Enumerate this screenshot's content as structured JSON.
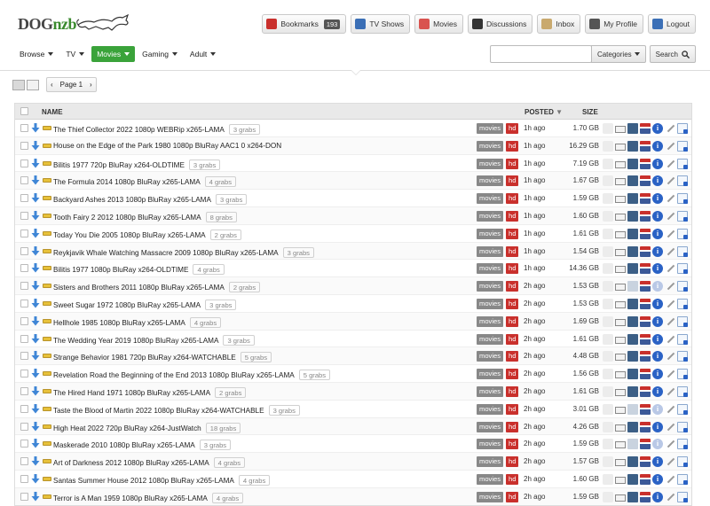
{
  "logo": {
    "part1": "DOG",
    "part2": "nzb"
  },
  "top_buttons": [
    {
      "label": "Bookmarks",
      "count": "193",
      "icon": "bookmark-icon",
      "color": "#c9302c"
    },
    {
      "label": "TV Shows",
      "icon": "tv-icon",
      "color": "#3b6fb6"
    },
    {
      "label": "Movies",
      "icon": "popcorn-icon",
      "color": "#d9534f"
    },
    {
      "label": "Discussions",
      "icon": "chat-bubble-icon",
      "color": "#333333"
    },
    {
      "label": "Inbox",
      "icon": "envelope-icon",
      "color": "#c9a96e"
    },
    {
      "label": "My Profile",
      "icon": "user-icon",
      "color": "#555555"
    },
    {
      "label": "Logout",
      "icon": "power-icon",
      "color": "#3b6fb6"
    }
  ],
  "nav": [
    {
      "label": "Browse"
    },
    {
      "label": "TV"
    },
    {
      "label": "Movies",
      "active": true
    },
    {
      "label": "Gaming"
    },
    {
      "label": "Adult"
    }
  ],
  "search": {
    "placeholder": "",
    "categories_label": "Categories",
    "search_label": "Search"
  },
  "pager": {
    "label": "Page 1"
  },
  "table": {
    "columns": {
      "name": "NAME",
      "posted": "POSTED",
      "size": "SIZE"
    },
    "rows": [
      {
        "title": "The Thief Collector 2022 1080p WEBRip x265-LAMA",
        "grabs": "3 grabs",
        "cat": "movies",
        "tag": "hd",
        "posted": "1h ago",
        "size": "1.70 GB",
        "active": true
      },
      {
        "title": "House on the Edge of the Park 1980 1080p BluRay AAC1 0 x264-DON",
        "grabs": "",
        "cat": "movies",
        "tag": "hd",
        "posted": "1h ago",
        "size": "16.29 GB",
        "active": true
      },
      {
        "title": "Bilitis 1977 720p BluRay x264-OLDTIME",
        "grabs": "3 grabs",
        "cat": "movies",
        "tag": "hd",
        "posted": "1h ago",
        "size": "7.19 GB",
        "active": true
      },
      {
        "title": "The Formula 2014 1080p BluRay x265-LAMA",
        "grabs": "4 grabs",
        "cat": "movies",
        "tag": "hd",
        "posted": "1h ago",
        "size": "1.67 GB",
        "active": true
      },
      {
        "title": "Backyard Ashes 2013 1080p BluRay x265-LAMA",
        "grabs": "3 grabs",
        "cat": "movies",
        "tag": "hd",
        "posted": "1h ago",
        "size": "1.59 GB",
        "active": true
      },
      {
        "title": "Tooth Fairy 2 2012 1080p BluRay x265-LAMA",
        "grabs": "8 grabs",
        "cat": "movies",
        "tag": "hd",
        "posted": "1h ago",
        "size": "1.60 GB",
        "active": true
      },
      {
        "title": "Today You Die 2005 1080p BluRay x265-LAMA",
        "grabs": "2 grabs",
        "cat": "movies",
        "tag": "hd",
        "posted": "1h ago",
        "size": "1.61 GB",
        "active": true
      },
      {
        "title": "Reykjavik Whale Watching Massacre 2009 1080p BluRay x265-LAMA",
        "grabs": "3 grabs",
        "cat": "movies",
        "tag": "hd",
        "posted": "1h ago",
        "size": "1.54 GB",
        "active": true
      },
      {
        "title": "Bilitis 1977 1080p BluRay x264-OLDTIME",
        "grabs": "4 grabs",
        "cat": "movies",
        "tag": "hd",
        "posted": "1h ago",
        "size": "14.36 GB",
        "active": true
      },
      {
        "title": "Sisters and Brothers 2011 1080p BluRay x265-LAMA",
        "grabs": "2 grabs",
        "cat": "movies",
        "tag": "hd",
        "posted": "2h ago",
        "size": "1.53 GB",
        "active": false
      },
      {
        "title": "Sweet Sugar 1972 1080p BluRay x265-LAMA",
        "grabs": "3 grabs",
        "cat": "movies",
        "tag": "hd",
        "posted": "2h ago",
        "size": "1.53 GB",
        "active": true
      },
      {
        "title": "Hellhole 1985 1080p BluRay x265-LAMA",
        "grabs": "4 grabs",
        "cat": "movies",
        "tag": "hd",
        "posted": "2h ago",
        "size": "1.69 GB",
        "active": true
      },
      {
        "title": "The Wedding Year 2019 1080p BluRay x265-LAMA",
        "grabs": "3 grabs",
        "cat": "movies",
        "tag": "hd",
        "posted": "2h ago",
        "size": "1.61 GB",
        "active": true
      },
      {
        "title": "Strange Behavior 1981 720p BluRay x264-WATCHABLE",
        "grabs": "5 grabs",
        "cat": "movies",
        "tag": "hd",
        "posted": "2h ago",
        "size": "4.48 GB",
        "active": true
      },
      {
        "title": "Revelation Road the Beginning of the End 2013 1080p BluRay x265-LAMA",
        "grabs": "5 grabs",
        "cat": "movies",
        "tag": "hd",
        "posted": "2h ago",
        "size": "1.56 GB",
        "active": true
      },
      {
        "title": "The Hired Hand 1971 1080p BluRay x265-LAMA",
        "grabs": "2 grabs",
        "cat": "movies",
        "tag": "hd",
        "posted": "2h ago",
        "size": "1.61 GB",
        "active": true
      },
      {
        "title": "Taste the Blood of Martin 2022 1080p BluRay x264-WATCHABLE",
        "grabs": "3 grabs",
        "cat": "movies",
        "tag": "hd",
        "posted": "2h ago",
        "size": "3.01 GB",
        "active": false
      },
      {
        "title": "High Heat 2022 720p BluRay x264-JustWatch",
        "grabs": "18 grabs",
        "cat": "movies",
        "tag": "hd",
        "posted": "2h ago",
        "size": "4.26 GB",
        "active": true
      },
      {
        "title": "Maskerade 2010 1080p BluRay x265-LAMA",
        "grabs": "3 grabs",
        "cat": "movies",
        "tag": "hd",
        "posted": "2h ago",
        "size": "1.59 GB",
        "active": false
      },
      {
        "title": "Art of Darkness 2012 1080p BluRay x265-LAMA",
        "grabs": "4 grabs",
        "cat": "movies",
        "tag": "hd",
        "posted": "2h ago",
        "size": "1.57 GB",
        "active": true
      },
      {
        "title": "Santas Summer House 2012 1080p BluRay x265-LAMA",
        "grabs": "4 grabs",
        "cat": "movies",
        "tag": "hd",
        "posted": "2h ago",
        "size": "1.60 GB",
        "active": true
      },
      {
        "title": "Terror is A Man 1959 1080p BluRay x265-LAMA",
        "grabs": "4 grabs",
        "cat": "movies",
        "tag": "hd",
        "posted": "2h ago",
        "size": "1.59 GB",
        "active": true
      }
    ]
  }
}
